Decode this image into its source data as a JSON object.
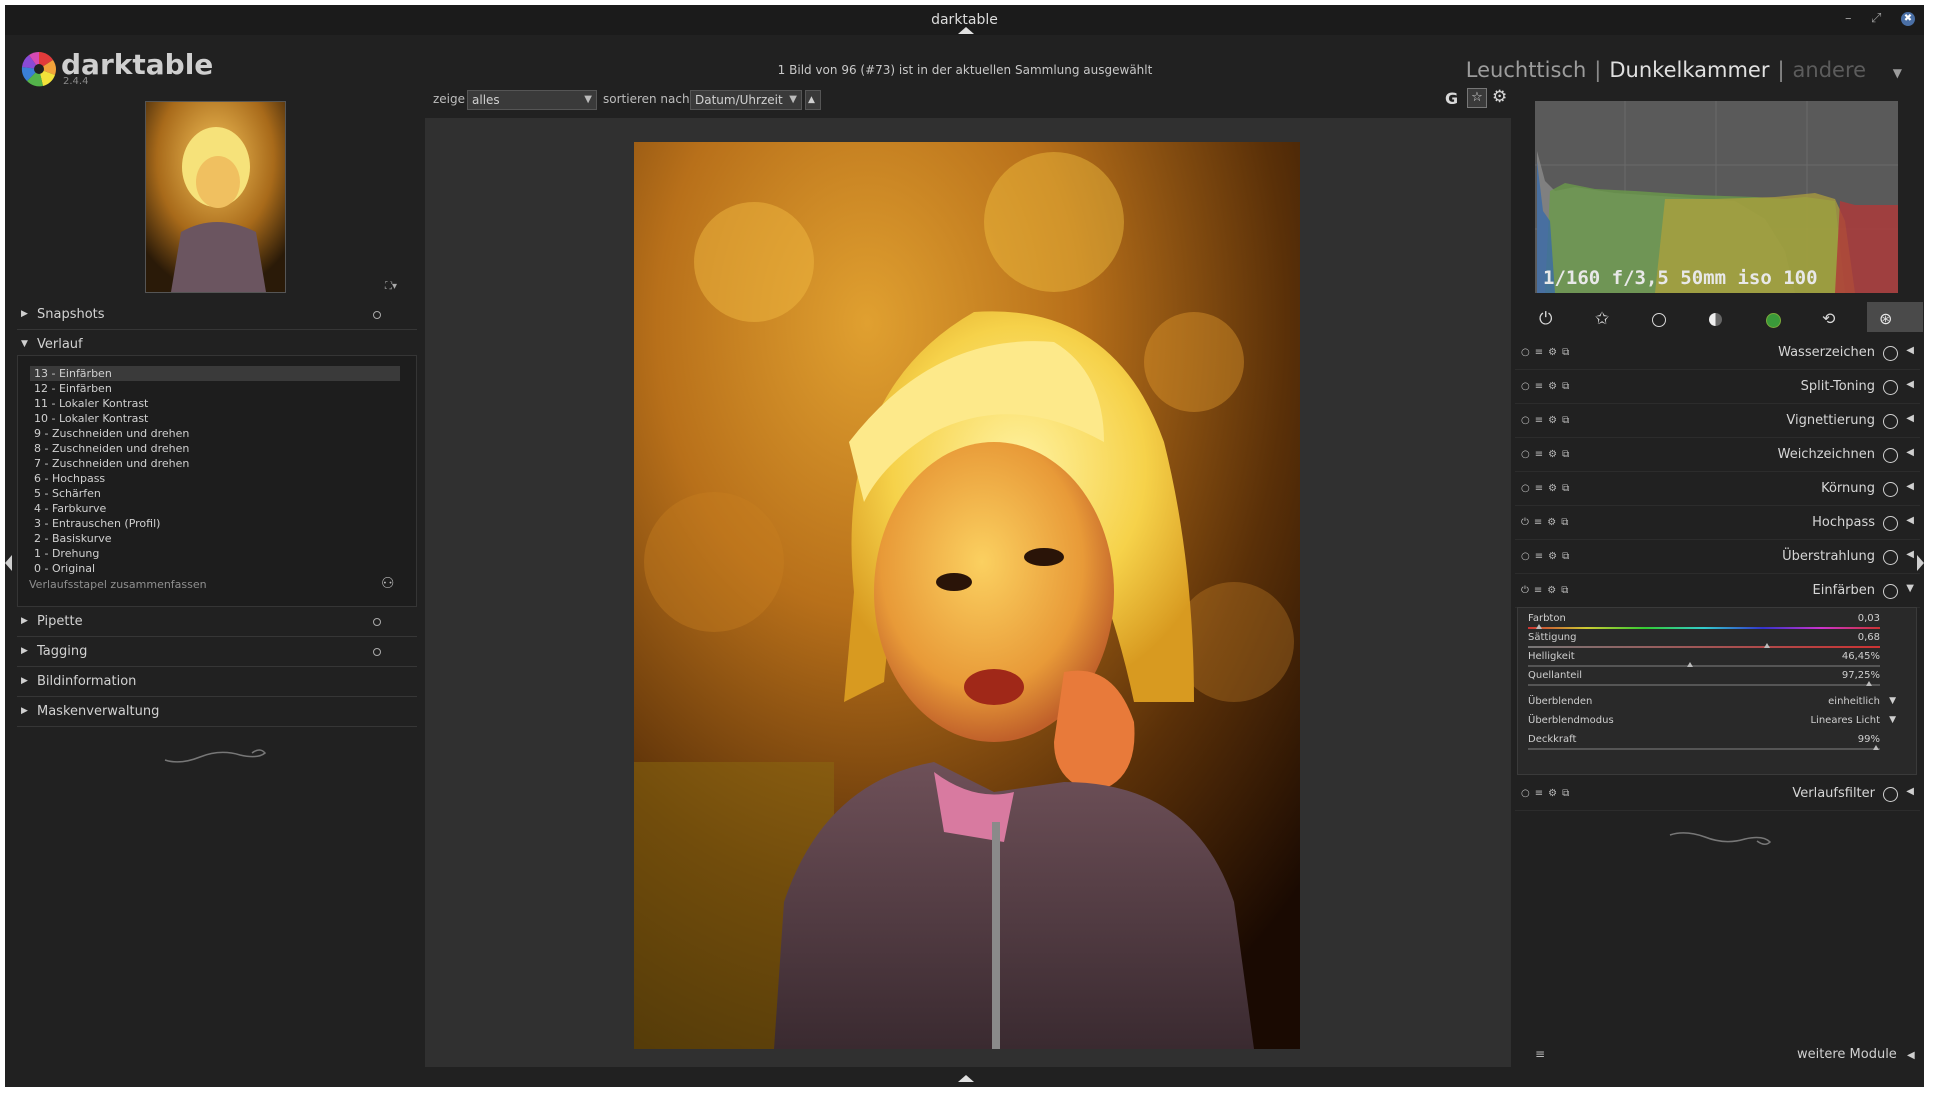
{
  "window": {
    "title": "darktable",
    "controls": [
      "–",
      "⤢",
      "✖"
    ]
  },
  "app": {
    "name": "darktable",
    "version": "2.4.4"
  },
  "header": {
    "selection_info": "1 Bild von 96 (#73) ist in der aktuellen Sammlung ausgewählt",
    "views": {
      "lighttable": "Leuchttisch",
      "darkroom": "Dunkelkammer",
      "other": "andere",
      "separator": "|"
    }
  },
  "filterbar": {
    "show_label": "zeige",
    "show_value": "alles",
    "sort_label": "sortieren nach",
    "sort_value": "Datum/Uhrzeit",
    "sort_dir": "▲",
    "grouping": "G"
  },
  "left_panel": {
    "sections": {
      "snapshots": "Snapshots",
      "history": "Verlauf",
      "colorpicker": "Pipette",
      "tagging": "Tagging",
      "image_info": "Bildinformation",
      "masks": "Maskenverwaltung"
    },
    "history_items": [
      "13 - Einfärben",
      "12 - Einfärben",
      "11 - Lokaler Kontrast",
      "10 - Lokaler Kontrast",
      "9 - Zuschneiden und drehen",
      "8 - Zuschneiden und drehen",
      "7 - Zuschneiden und drehen",
      "6 - Hochpass",
      "5 - Schärfen",
      "4 - Farbkurve",
      "3 - Entrauschen (Profil)",
      "2 - Basiskurve",
      "1 - Drehung",
      "0 - Original"
    ],
    "compress_label": "Verlaufsstapel zusammenfassen"
  },
  "right_panel": {
    "exif": "1/160 f/3,5 50mm iso 100",
    "modules": [
      "Wasserzeichen",
      "Split-Toning",
      "Vignettierung",
      "Weichzeichnen",
      "Körnung",
      "Hochpass",
      "Überstrahlung",
      "Einfärben",
      "Verlaufsfilter"
    ],
    "colorize": {
      "sliders": [
        {
          "label": "Farbton",
          "value": "0,03",
          "pos": 0.03
        },
        {
          "label": "Sättigung",
          "value": "0,68",
          "pos": 0.68
        },
        {
          "label": "Helligkeit",
          "value": "46,45%",
          "pos": 0.46
        },
        {
          "label": "Quellanteil",
          "value": "97,25%",
          "pos": 0.97
        }
      ],
      "blend": {
        "label": "Überblenden",
        "value": "einheitlich"
      },
      "blend_mode": {
        "label": "Überblendmodus",
        "value": "Lineares Licht"
      },
      "opacity": {
        "label": "Deckkraft",
        "value": "99%",
        "pos": 0.99
      }
    },
    "more_modules": "weitere Module"
  },
  "colors": {
    "background": "#212121",
    "center": "#303030",
    "text": "#c8c8c8"
  }
}
